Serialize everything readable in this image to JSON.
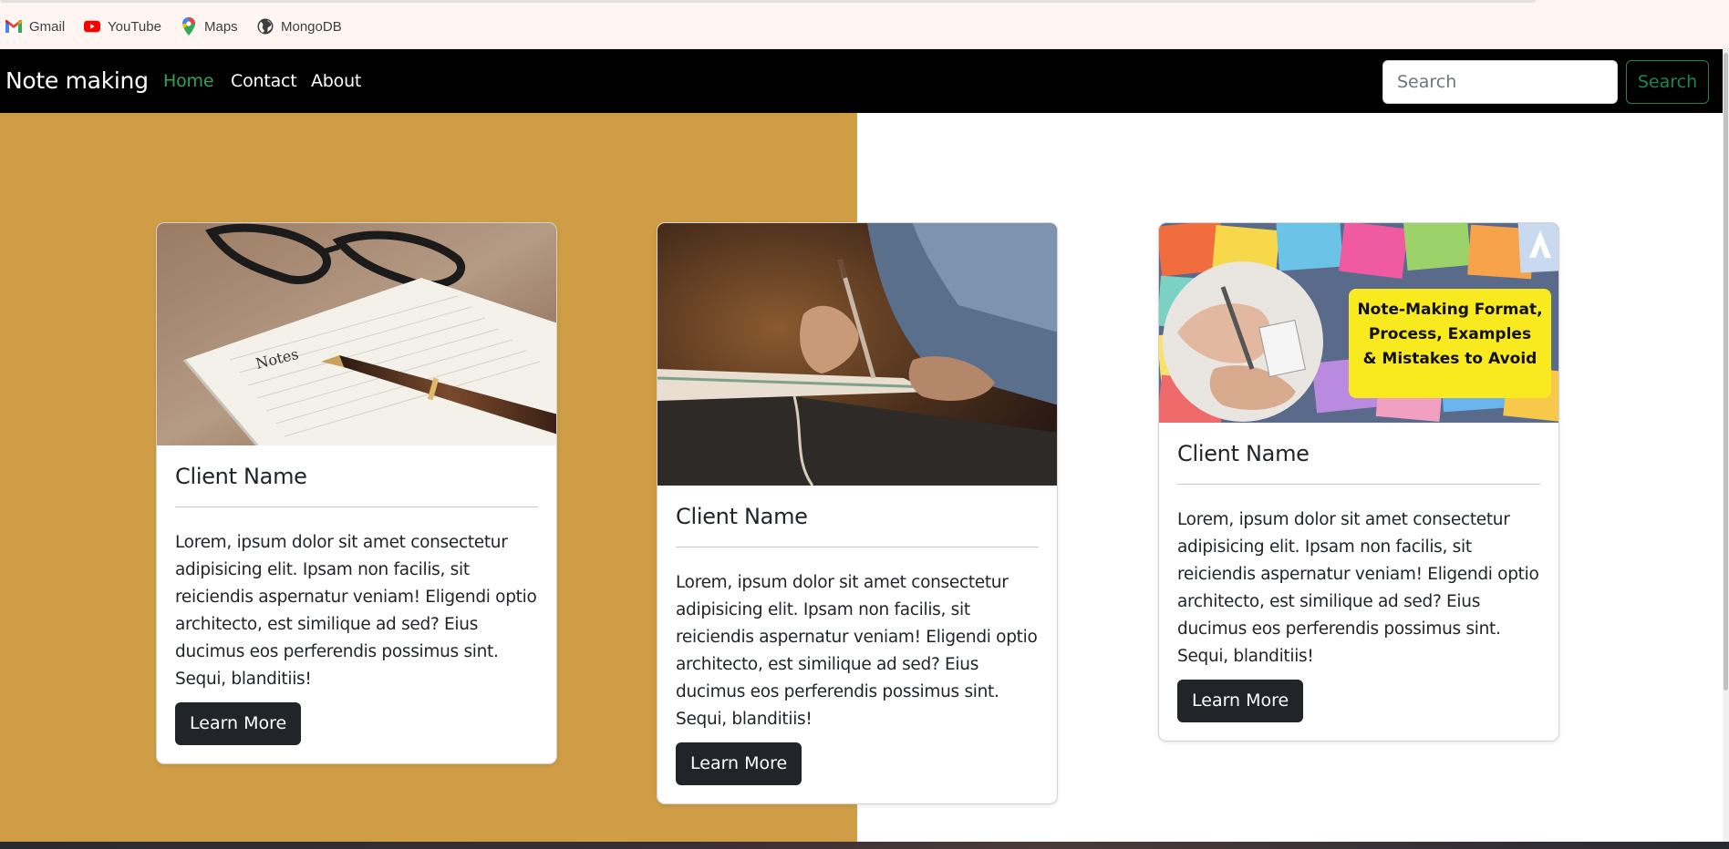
{
  "bookmarks": [
    {
      "label": "Gmail",
      "icon": "gmail-icon"
    },
    {
      "label": "YouTube",
      "icon": "youtube-icon"
    },
    {
      "label": "Maps",
      "icon": "maps-icon"
    },
    {
      "label": "MongoDB",
      "icon": "globe-icon"
    }
  ],
  "navbar": {
    "brand": "Note making",
    "links": [
      {
        "label": "Home",
        "active": true
      },
      {
        "label": "Contact",
        "active": false
      },
      {
        "label": "About",
        "active": false
      }
    ],
    "search_placeholder": "Search",
    "search_value": "",
    "search_button": "Search"
  },
  "hero": {
    "left_bg_color": "#cf9d45",
    "right_bg_color": "#ffffff"
  },
  "cards": [
    {
      "title": "Client Name",
      "text": "Lorem, ipsum dolor sit amet consectetur adipisicing elit. Ipsam non facilis, sit reiciendis aspernatur veniam! Eligendi optio architecto, est similique ad sed? Eius ducimus eos perferendis possimus sint. Sequi, blanditiis!",
      "button": "Learn More",
      "image": {
        "handwritten_text": "Notes"
      }
    },
    {
      "title": "Client Name",
      "text": "Lorem, ipsum dolor sit amet consectetur adipisicing elit. Ipsam non facilis, sit reiciendis aspernatur veniam! Eligendi optio architecto, est similique ad sed? Eius ducimus eos perferendis possimus sint. Sequi, blanditiis!",
      "button": "Learn More"
    },
    {
      "title": "Client Name",
      "text": "Lorem, ipsum dolor sit amet consectetur adipisicing elit. Ipsam non facilis, sit reiciendis aspernatur veniam! Eligendi optio architecto, est similique ad sed? Eius ducimus eos perferendis possimus sint. Sequi, blanditiis!",
      "button": "Learn More",
      "image": {
        "banner_lines": [
          "Note-Making Format,",
          "Process, Examples",
          "& Mistakes to Avoid"
        ]
      }
    }
  ],
  "colors": {
    "accent_link": "#2fa35a",
    "search_border": "#198754",
    "button_dark": "#212529",
    "navbar_bg": "#000000"
  }
}
